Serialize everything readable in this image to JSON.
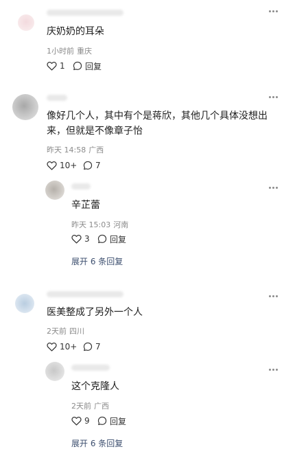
{
  "comments": [
    {
      "content": "庆奶奶的耳朵",
      "time": "1小时前",
      "location": "重庆",
      "likes": "1",
      "reply_label": "回复"
    },
    {
      "content_line1": "像好几个人，其中有个是蒋欣，其他几个具体没想出",
      "content_line2": "来，但就是不像章子怡",
      "time": "昨天 14:58",
      "location": "广西",
      "likes": "10+",
      "replies": "7",
      "reply": {
        "content": "辛芷蕾",
        "time": "昨天 15:03",
        "location": "河南",
        "likes": "3",
        "reply_label": "回复"
      },
      "expand_label": "展开 6 条回复"
    },
    {
      "content": "医美整成了另外一个人",
      "time": "2天前",
      "location": "四川",
      "likes": "10+",
      "replies": "7",
      "reply": {
        "content": "这个克隆人",
        "time": "2天前",
        "location": "广西",
        "likes": "9",
        "reply_label": "回复"
      },
      "expand_label": "展开 6 条回复"
    }
  ]
}
